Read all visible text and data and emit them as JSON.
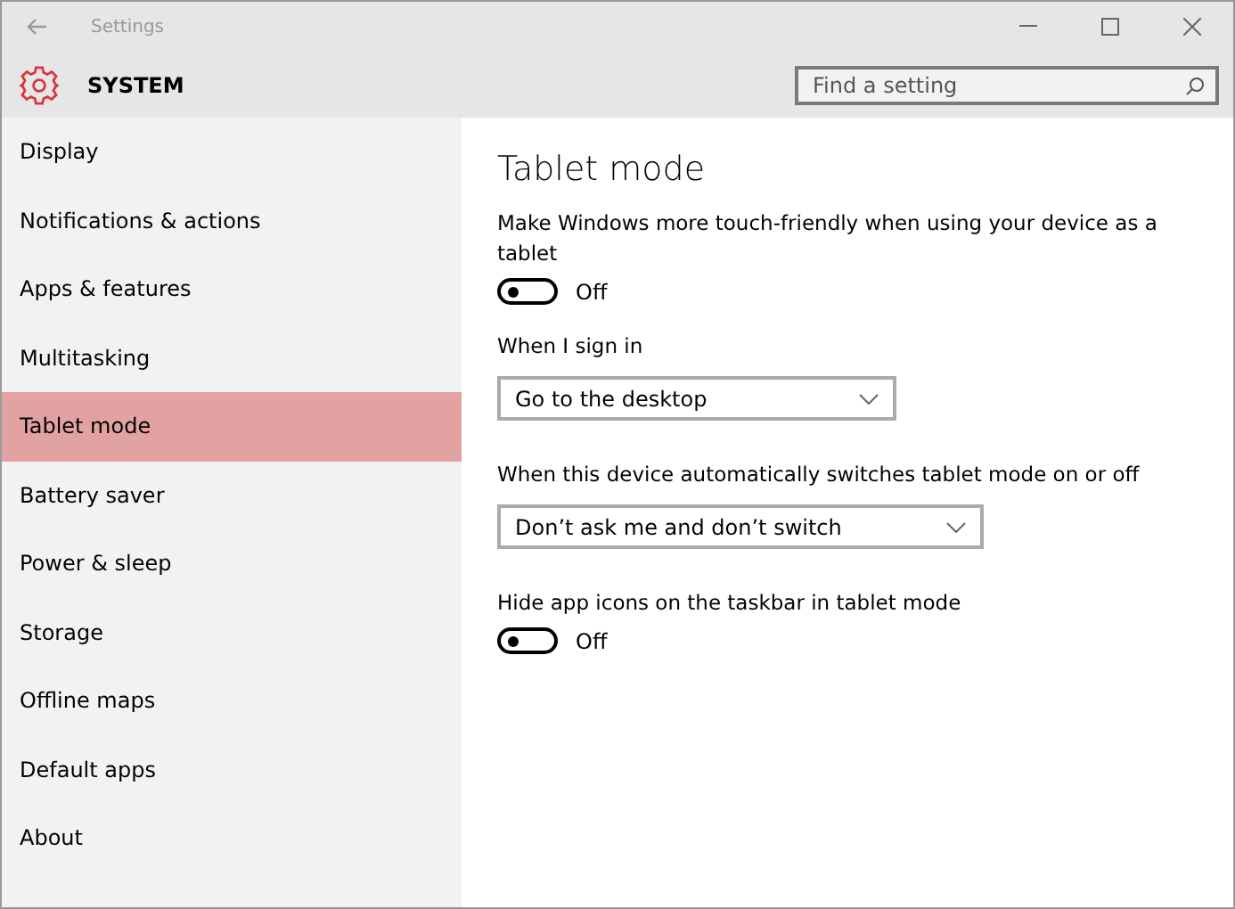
{
  "window": {
    "title": "Settings"
  },
  "header": {
    "title": "SYSTEM",
    "search": {
      "placeholder": "Find a setting"
    }
  },
  "sidebar": {
    "items": [
      {
        "label": "Display",
        "selected": false
      },
      {
        "label": "Notifications & actions",
        "selected": false
      },
      {
        "label": "Apps & features",
        "selected": false
      },
      {
        "label": "Multitasking",
        "selected": false
      },
      {
        "label": "Tablet mode",
        "selected": true
      },
      {
        "label": "Battery saver",
        "selected": false
      },
      {
        "label": "Power & sleep",
        "selected": false
      },
      {
        "label": "Storage",
        "selected": false
      },
      {
        "label": "Offline maps",
        "selected": false
      },
      {
        "label": "Default apps",
        "selected": false
      },
      {
        "label": "About",
        "selected": false
      }
    ]
  },
  "content": {
    "title": "Tablet mode",
    "settings": [
      {
        "kind": "toggle",
        "label": "Make Windows more touch-friendly when using your device as a tablet",
        "on": false,
        "state": "Off"
      },
      {
        "kind": "dropdown",
        "label": "When I sign in",
        "value": "Go to the desktop"
      },
      {
        "kind": "dropdown",
        "label": "When this device automatically switches tablet mode on or off",
        "value": "Don’t ask me and don’t switch"
      },
      {
        "kind": "toggle",
        "label": "Hide app icons on the taskbar in tablet mode",
        "on": false,
        "state": "Off"
      }
    ]
  }
}
